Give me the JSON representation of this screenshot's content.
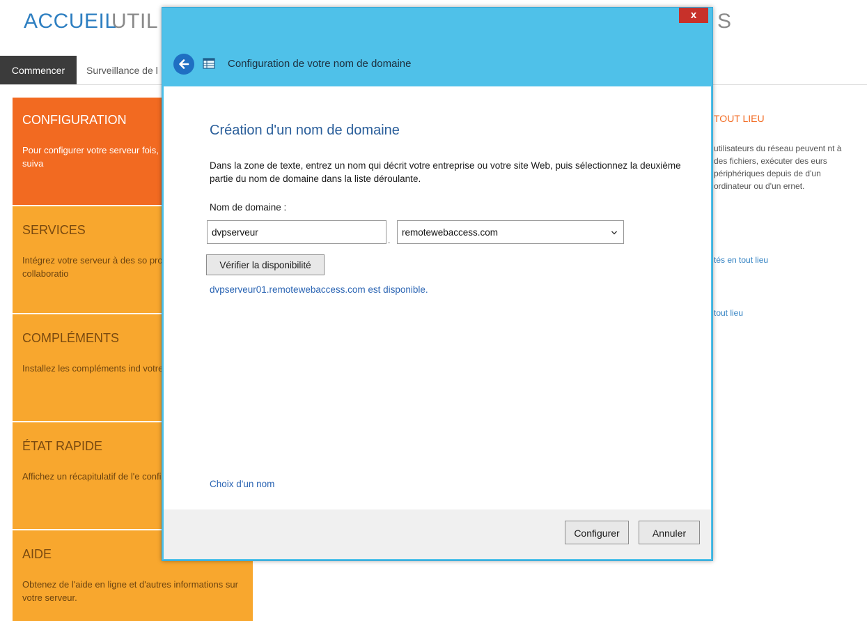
{
  "top_nav": {
    "accueil": "ACCUEIL",
    "util": "UTIL",
    "right_fragment": "S"
  },
  "sub_nav": {
    "active_tab": "Commencer",
    "tab2": "Surveillance de l"
  },
  "tiles": {
    "configuration": {
      "title": "CONFIGURATION",
      "desc": "Pour configurer votre serveur fois, exécutez les tâches suiva"
    },
    "services": {
      "title": "SERVICES",
      "desc": "Intégrez votre serveur à des so productivité et de collaboratio"
    },
    "complements": {
      "title": "COMPLÉMENTS",
      "desc": "Installez les compléments ind votre entreprise."
    },
    "etat": {
      "title": "ÉTAT RAPIDE",
      "desc": "Affichez un récapitulatif de l'e configuration du serveur."
    },
    "aide": {
      "title": "AIDE",
      "desc": "Obtenez de l'aide en ligne et d'autres informations sur votre serveur."
    }
  },
  "right_panel": {
    "title": "TOUT LIEU",
    "desc": "utilisateurs du réseau peuvent nt à des fichiers, exécuter des eurs périphériques depuis de d'un ordinateur ou d'un ernet.",
    "link1": "tés en tout lieu",
    "link2": "tout lieu"
  },
  "dialog": {
    "close_label": "x",
    "title": "Configuration de votre nom de domaine",
    "heading": "Création d'un nom de domaine",
    "instructions": "Dans la zone de texte, entrez un nom qui décrit votre entreprise ou votre site Web, puis sélectionnez la deuxième partie du nom de domaine dans la liste déroulante.",
    "domain_label": "Nom de domaine :",
    "domain_value": "dvpserveur",
    "separator": ".",
    "suffix_selected": "remotewebaccess.com",
    "verify_button": "Vérifier la disponibilité",
    "result_text": "dvpserveur01.remotewebaccess.com est disponible.",
    "choose_link": "Choix d'un nom",
    "configure_button": "Configurer",
    "cancel_button": "Annuler"
  },
  "colors": {
    "accent_blue": "#2e7fc1",
    "dialog_frame": "#4fc1e9",
    "tile_orange": "#f26a21",
    "tile_amber": "#f8a72e",
    "close_red": "#c7312a"
  }
}
